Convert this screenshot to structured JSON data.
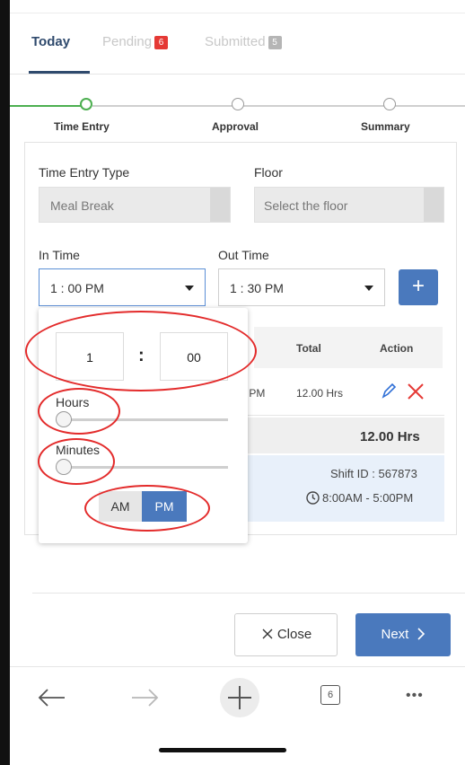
{
  "tabs": [
    {
      "label": "Today",
      "active": true
    },
    {
      "label": "Pending",
      "badge": "6"
    },
    {
      "label": "Submitted",
      "badge": "5"
    }
  ],
  "steps": [
    {
      "label": "Time Entry",
      "active": true
    },
    {
      "label": "Approval"
    },
    {
      "label": "Summary"
    }
  ],
  "form": {
    "time_entry_type_label": "Time Entry Type",
    "time_entry_type_value": "Meal Break",
    "floor_label": "Floor",
    "floor_placeholder": "Select the floor",
    "in_time_label": "In Time",
    "in_time_value": "1 : 00 PM",
    "out_time_label": "Out Time",
    "out_time_value": "1 : 30 PM",
    "add_label": "+"
  },
  "table": {
    "headers": [
      "Total",
      "Action"
    ],
    "row": {
      "out_partial": ") PM",
      "total": "12.00 Hrs"
    },
    "grand_total": "12.00 Hrs",
    "shift_id": "Shift ID : 567873",
    "shift_time": "8:00AM - 5:00PM"
  },
  "time_picker": {
    "hour": "1",
    "separator": ":",
    "minute": "00",
    "hours_label": "Hours",
    "minutes_label": "Minutes",
    "hours_level": 0,
    "minutes_level": 0,
    "am_label": "AM",
    "pm_label": "PM",
    "selected_period": "PM"
  },
  "footer": {
    "close_label": "Close",
    "next_label": "Next"
  },
  "browser": {
    "tab_count": "6",
    "more": "•••"
  },
  "colors": {
    "accent": "#4a79bd",
    "step_active": "#4caf50",
    "annotation": "#e32b2b",
    "badge_red": "#e53935"
  }
}
